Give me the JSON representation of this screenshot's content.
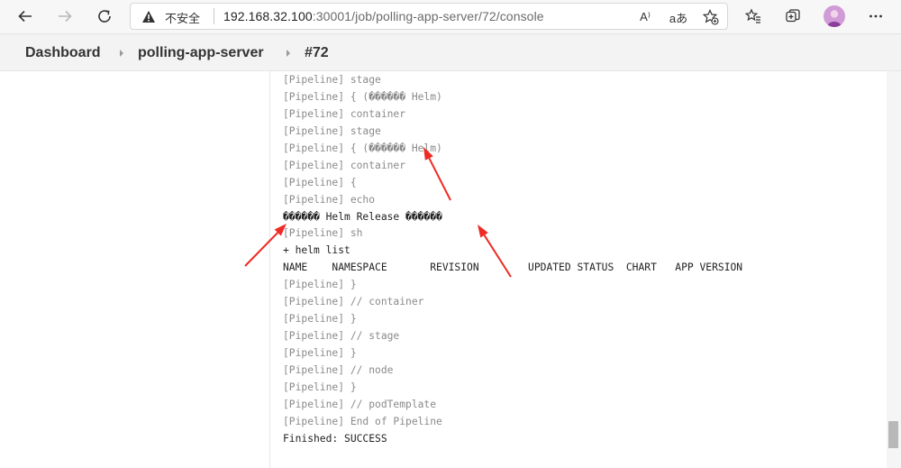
{
  "browser": {
    "security_label": "不安全",
    "url_host": "192.168.32.100",
    "url_path": ":30001/job/polling-app-server/72/console",
    "read_aloud_icon": "A⁾",
    "translate_icon": "aあ"
  },
  "breadcrumb": {
    "items": [
      "Dashboard",
      "polling-app-server",
      "#72"
    ]
  },
  "console": {
    "lines": [
      {
        "prefix": "[Pipeline]",
        "text": " stage"
      },
      {
        "prefix": "[Pipeline]",
        "text": " { (������ Helm)"
      },
      {
        "prefix": "[Pipeline]",
        "text": " container"
      },
      {
        "prefix": "[Pipeline]",
        "text": " stage"
      },
      {
        "prefix": "[Pipeline]",
        "text": " { (������ Helm)"
      },
      {
        "prefix": "[Pipeline]",
        "text": " container"
      },
      {
        "prefix": "[Pipeline]",
        "text": " {"
      },
      {
        "prefix": "[Pipeline]",
        "text": " echo"
      },
      {
        "prefix": "",
        "text": "������ Helm Release ������"
      },
      {
        "prefix": "[Pipeline]",
        "text": " sh"
      },
      {
        "prefix": "",
        "text": "+ helm list"
      },
      {
        "prefix": "",
        "text": "NAME    NAMESPACE       REVISION        UPDATED STATUS  CHART   APP VERSION"
      },
      {
        "prefix": "[Pipeline]",
        "text": " }"
      },
      {
        "prefix": "[Pipeline]",
        "text": " // container"
      },
      {
        "prefix": "[Pipeline]",
        "text": " }"
      },
      {
        "prefix": "[Pipeline]",
        "text": " // stage"
      },
      {
        "prefix": "[Pipeline]",
        "text": " }"
      },
      {
        "prefix": "[Pipeline]",
        "text": " // node"
      },
      {
        "prefix": "[Pipeline]",
        "text": " }"
      },
      {
        "prefix": "[Pipeline]",
        "text": " // podTemplate"
      },
      {
        "prefix": "[Pipeline]",
        "text": " End of Pipeline"
      },
      {
        "prefix": "",
        "text": "Finished: SUCCESS"
      }
    ]
  },
  "colors": {
    "annotation_arrow": "#ee2b24",
    "pipeline_prefix": "#8a8a8a"
  }
}
